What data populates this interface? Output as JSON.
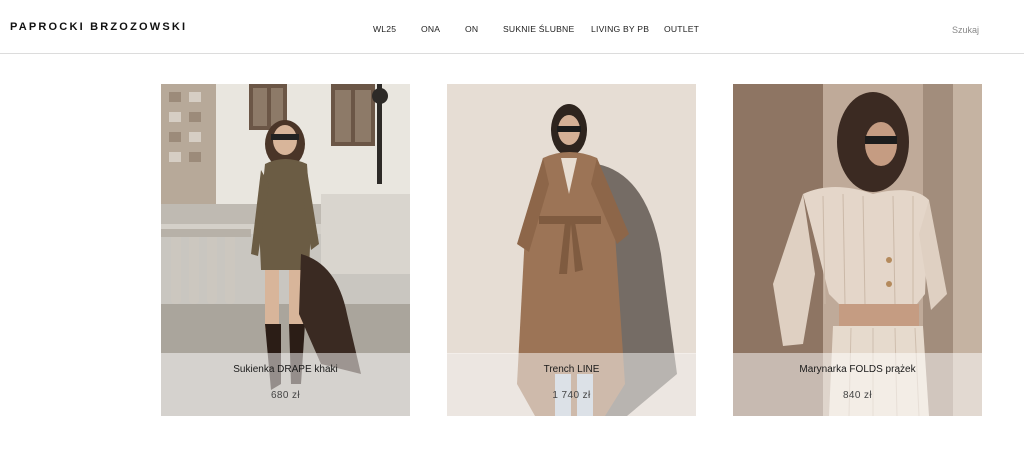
{
  "brand": {
    "logo": "PAPROCKI BRZOZOWSKI"
  },
  "nav": {
    "items": [
      {
        "label": "WL25"
      },
      {
        "label": "ONA"
      },
      {
        "label": "ON"
      },
      {
        "label": "SUKNIE ŚLUBNE"
      },
      {
        "label": "LIVING BY PB"
      },
      {
        "label": "OUTLET"
      }
    ]
  },
  "search": {
    "label": "Szukaj"
  },
  "products": [
    {
      "name": "Sukienka DRAPE khaki",
      "price": "680 zł",
      "image": "photo-woman-khaki-dress-on-terrace"
    },
    {
      "name": "Trench LINE",
      "price": "1 740 zł",
      "image": "photo-woman-camel-trench-coat"
    },
    {
      "name": "Marynarka FOLDS prążek",
      "price": "840 zł",
      "image": "photo-woman-pinstripe-cropped-blazer"
    }
  ]
}
